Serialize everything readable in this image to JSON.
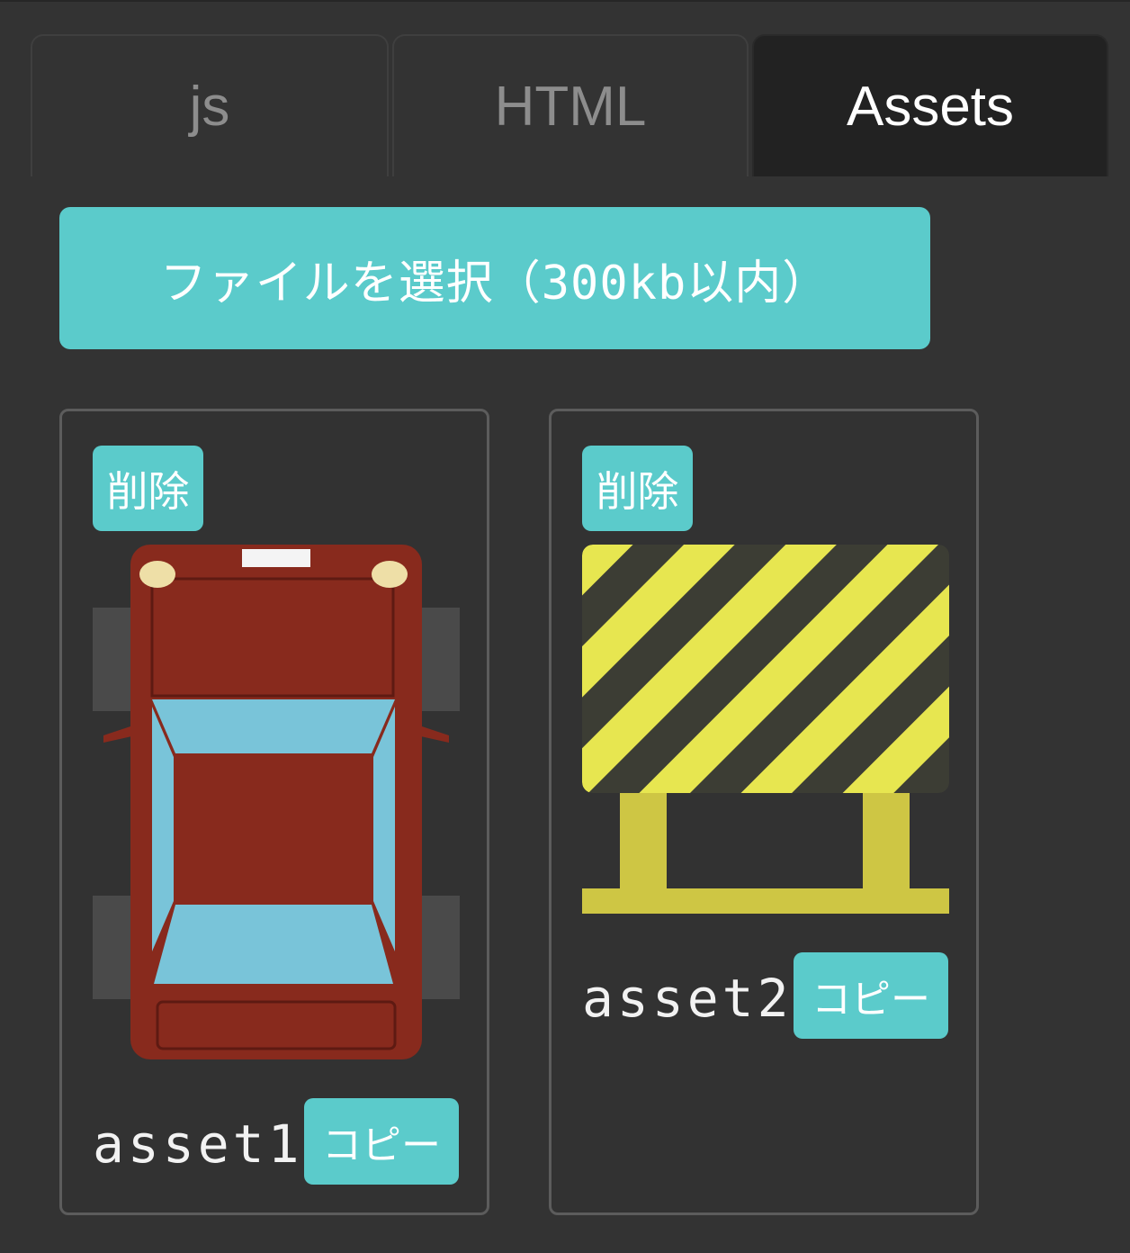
{
  "tabs": [
    {
      "label": "js",
      "active": false
    },
    {
      "label": "HTML",
      "active": false
    },
    {
      "label": "Assets",
      "active": true
    }
  ],
  "file_select": {
    "label": "ファイルを選択（300kb以内）"
  },
  "assets": [
    {
      "name": "asset1",
      "delete_label": "削除",
      "copy_label": "コピー",
      "image": "red-car-top-view"
    },
    {
      "name": "asset2",
      "delete_label": "削除",
      "copy_label": "コピー",
      "image": "striped-road-barrier"
    }
  ],
  "colors": {
    "background": "#333333",
    "active_tab": "#222222",
    "accent": "#5bcbcb",
    "card_border": "#5c5c5c"
  }
}
